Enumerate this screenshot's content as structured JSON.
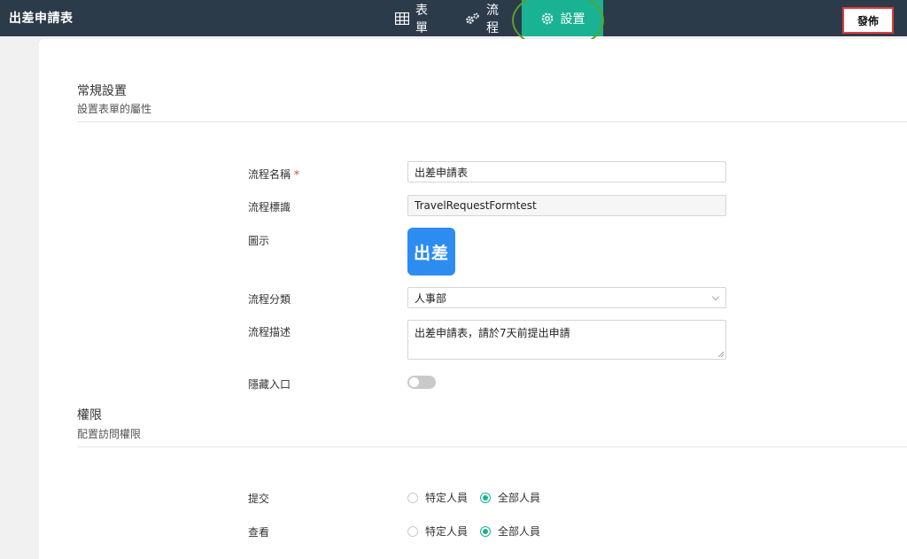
{
  "header": {
    "app_title": "出差申請表",
    "tabs": [
      {
        "label": "表單",
        "icon": "grid-icon"
      },
      {
        "label": "流程",
        "icon": "gears-icon"
      },
      {
        "label": "設置",
        "icon": "gear-icon",
        "active": true
      }
    ],
    "publish_label": "發佈"
  },
  "general": {
    "title": "常規設置",
    "subtitle": "設置表單的屬性",
    "fields": {
      "name": {
        "label": "流程名稱",
        "required_mark": "*",
        "value": "出差申請表"
      },
      "identifier": {
        "label": "流程標識",
        "value": "TravelRequestFormtest"
      },
      "icon": {
        "label": "圖示",
        "icon_text": "出差"
      },
      "category": {
        "label": "流程分類",
        "value": "人事部"
      },
      "description": {
        "label": "流程描述",
        "value": "出差申請表，請於7天前提出申請"
      },
      "hide_entry": {
        "label": "隱藏入口",
        "enabled": false
      }
    }
  },
  "permissions": {
    "title": "權限",
    "subtitle": "配置訪問權限",
    "submit": {
      "label": "提交",
      "options": [
        "特定人員",
        "全部人員"
      ],
      "selected": "全部人員"
    },
    "view": {
      "label": "查看",
      "options": [
        "特定人員",
        "全部人員"
      ],
      "selected": "全部人員"
    }
  },
  "colors": {
    "topbar": "#2c3b4a",
    "accent": "#19b393",
    "icon_bg": "#2d8cf0",
    "highlight_ring": "#5aa12a",
    "publish_border": "#e23b3b"
  }
}
